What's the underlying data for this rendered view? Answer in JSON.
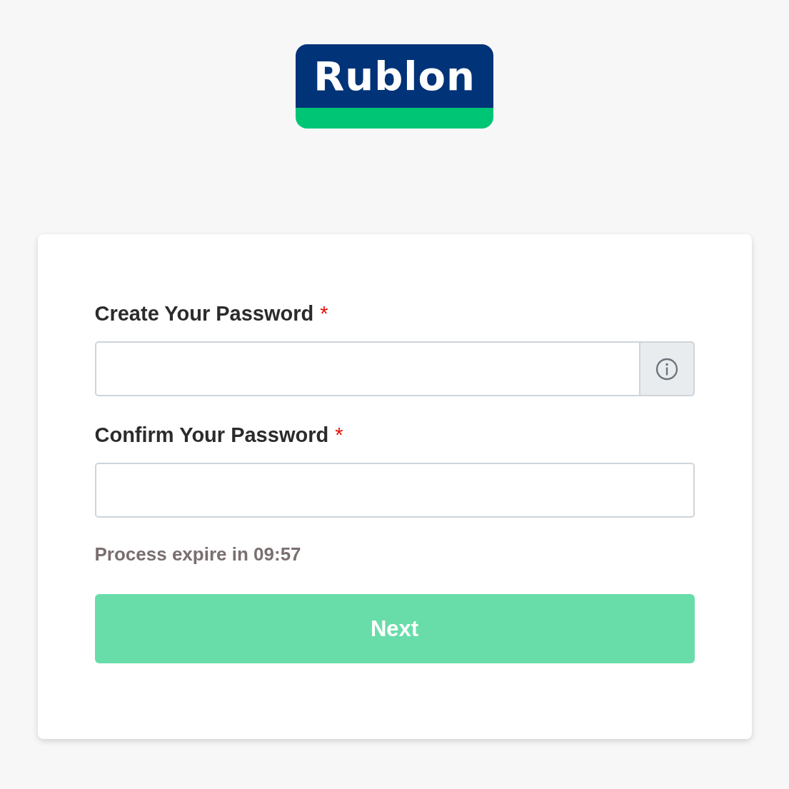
{
  "logo": {
    "text": "Rublon"
  },
  "fields": [
    {
      "label": "Create Your Password",
      "required_mark": "*",
      "kind": "with_info"
    },
    {
      "label": "Confirm Your Password",
      "required_mark": "*",
      "kind": "plain"
    }
  ],
  "timer": "Process expire in 09:57",
  "button": {
    "label": "Next",
    "disabled": true
  }
}
